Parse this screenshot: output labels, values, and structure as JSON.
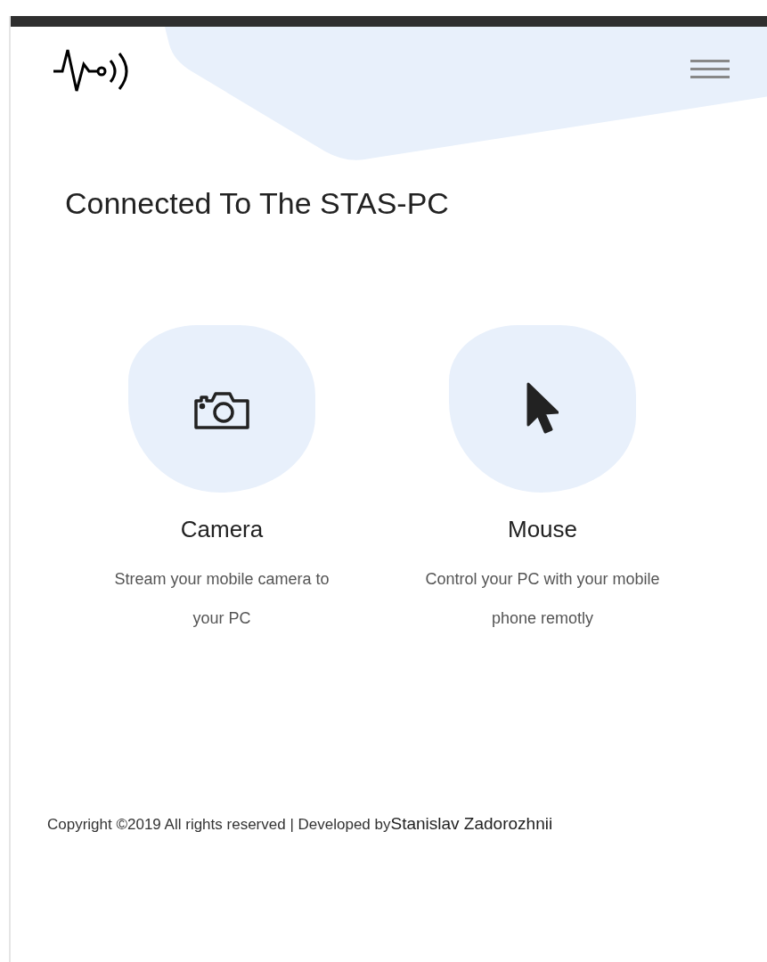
{
  "title": "Connected To The STAS-PC",
  "features": [
    {
      "kind": "camera",
      "title": "Camera",
      "description": "Stream your mobile camera to your PC"
    },
    {
      "kind": "mouse",
      "title": "Mouse",
      "description": "Control your PC with your mobile phone remotly"
    }
  ],
  "footer": {
    "text": "Copyright ©2019 All rights reserved | Developed by",
    "author": "Stanislav Zadorozhnii"
  }
}
